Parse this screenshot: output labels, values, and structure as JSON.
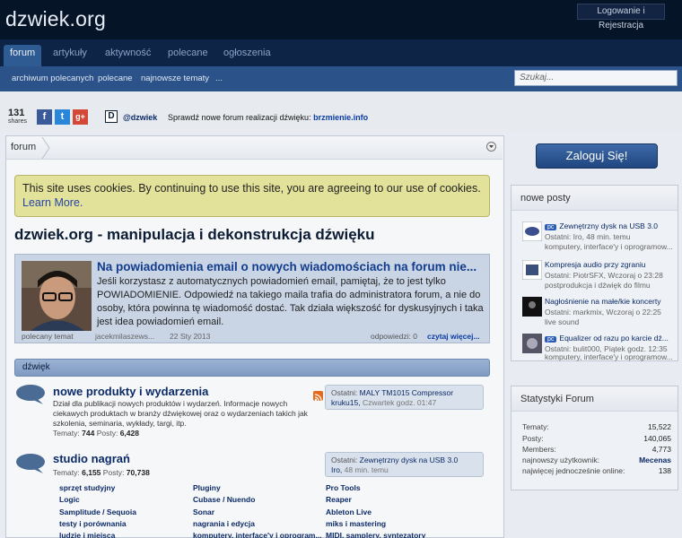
{
  "site": {
    "logo": "dzwiek.org",
    "login_link": "Logowanie i Rejestracja"
  },
  "nav": {
    "tabs": [
      "forum",
      "artykuły",
      "aktywność",
      "polecane",
      "ogłoszenia"
    ],
    "subtabs": [
      "archiwum polecanych",
      "polecane",
      "najnowsze tematy",
      "..."
    ],
    "search_placeholder": "Szukaj..."
  },
  "share": {
    "count": "131",
    "label": "shares",
    "buttons": [
      "f",
      "t",
      "g+"
    ],
    "d_logo": "D",
    "twitter": "@dzwiek",
    "promo_text": "Sprawdź nowe forum realizacji dźwięku:",
    "promo_link": "brzmienie.info"
  },
  "breadcrumb": {
    "home": "forum"
  },
  "cookie": {
    "text": "This site uses cookies. By continuing to use this site, you are agreeing to our use of cookies.",
    "learn_more": "Learn More."
  },
  "page_title": "dzwiek.org - manipulacja i dekonstrukcja dźwięku",
  "featured": {
    "title": "Na powiadomienia email o nowych wiadomościach na forum nie...",
    "excerpt": "Jeśli korzystasz z automatycznych powiadomień email, pamiętaj, że to jest tylko POWIADOMIENIE. Odpowiedź na takiego maila trafia do administratora forum, a nie do osoby, która powinna tę wiadomość dostać. Tak działa większość for dyskusyjnych i taka jest idea powiadomień email.",
    "label": "polecany temat",
    "author": "jacekmilaszews...",
    "date": "22 Sty 2013",
    "replies": "odpowiedzi: 0",
    "more": "czytaj więcej..."
  },
  "category": {
    "title": "dźwięk"
  },
  "forums": [
    {
      "title": "nowe produkty i wydarzenia",
      "desc": "Dział dla publikacji nowych produktów i wydarzeń. Informacje nowych ciekawych produktach w branży dźwiękowej oraz o wydarzeniach takich jak szkolenia, seminaria, wykłady, targi, itp.",
      "stats_topics_label": "Tematy:",
      "topics": "744",
      "stats_posts_label": "Posty:",
      "posts": "6,428",
      "last_label": "Ostatni:",
      "last_title": "MALY TM1015 Compressor",
      "last_user": "kruku15,",
      "last_time": "Czwartek godz. 01:47"
    },
    {
      "title": "studio nagrań",
      "desc": "",
      "stats_topics_label": "Tematy:",
      "topics": "6,155",
      "stats_posts_label": "Posty:",
      "posts": "70,738",
      "last_label": "Ostatni:",
      "last_title": "Zewnętrzny dysk na USB 3.0",
      "last_user": "Iro,",
      "last_time": "48 min. temu"
    }
  ],
  "subforums": [
    [
      "sprzęt studyjny",
      "Pluginy",
      "Pro Tools"
    ],
    [
      "Logic",
      "Cubase / Nuendo",
      "Reaper"
    ],
    [
      "Samplitude / Sequoia",
      "Sonar",
      "Ableton Live"
    ],
    [
      "testy i porównania",
      "nagrania i edycja",
      "miks i mastering"
    ],
    [
      "ludzie i miejsca",
      "komputery, interface'y i oprogram...",
      "MIDI, samplery, syntezatory"
    ]
  ],
  "sidebar": {
    "login_button": "Zaloguj Się!",
    "recent_title": "nowe posty",
    "recent": [
      {
        "prefix": "pc",
        "title": "Zewnętrzny dysk na USB 3.0",
        "meta1": "Ostatni: Iro, 48 min. temu",
        "meta2": "komputery, interface'y i oprogramow..."
      },
      {
        "prefix": "",
        "title": "Kompresja audio przy zgraniu",
        "meta1": "Ostatni: PiotrSFX, Wczoraj o 23:28",
        "meta2": "postprodukcja i dźwięk do filmu"
      },
      {
        "prefix": "",
        "title": "Nagłośnienie na małe/kie koncerty",
        "meta1": "Ostatni: markmix, Wczoraj o 22:25",
        "meta2": "live sound"
      },
      {
        "prefix": "pc",
        "title": "Equalizer od razu po karcie dź...",
        "meta1": "Ostatni: bulit000, Piątek godz. 12:35",
        "meta2": "komputery, interface'y i oprogramow..."
      }
    ],
    "stats_title": "Statystyki Forum",
    "stats": [
      {
        "label": "Tematy:",
        "value": "15,522"
      },
      {
        "label": "Posty:",
        "value": "140,065"
      },
      {
        "label": "Members:",
        "value": "4,773"
      },
      {
        "label": "najnowszy użytkownik:",
        "value": "Mecenas"
      },
      {
        "label": "najwięcej jednocześnie online:",
        "value": "138"
      }
    ]
  },
  "colors": {
    "header": "#061428",
    "nav": "#0d2447",
    "subnav": "#2b5289",
    "link": "#0b2a66",
    "cookie_bg": "#e3e29a"
  }
}
